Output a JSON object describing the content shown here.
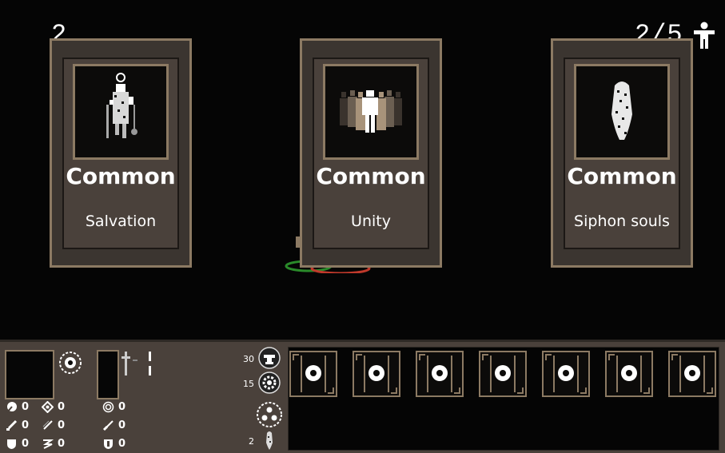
{
  "hud": {
    "wave": "2",
    "population": "2/5",
    "person_icon": "person-icon"
  },
  "cards": [
    {
      "rarity": "Common",
      "name": "Salvation",
      "icon": "robed-figure-icon"
    },
    {
      "rarity": "Common",
      "name": "Unity",
      "icon": "crowd-icon"
    },
    {
      "rarity": "Common",
      "name": "Siphon souls",
      "icon": "soul-wisp-icon"
    }
  ],
  "stats": {
    "col1": [
      "0",
      "0",
      "0"
    ],
    "col2": [
      "0",
      "0",
      "0"
    ],
    "col3": [
      "0",
      "0",
      "0"
    ]
  },
  "resources": {
    "anvil": "30",
    "gear": "15",
    "soul": "2"
  },
  "inventory_slots": 7
}
